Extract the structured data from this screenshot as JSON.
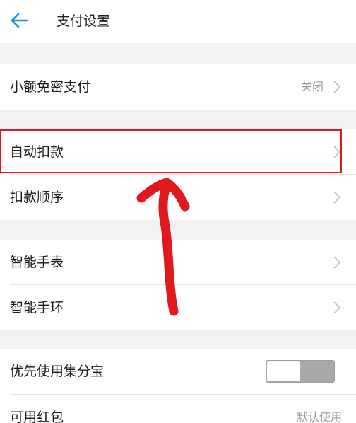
{
  "header": {
    "title": "支付设置",
    "back_icon": "arrow-left-icon",
    "accent": "#1a8ef0"
  },
  "rows": {
    "small_free_pay": {
      "label": "小额免密支付",
      "value": "关闭"
    },
    "auto_deduct": {
      "label": "自动扣款"
    },
    "deduct_order": {
      "label": "扣款顺序"
    },
    "smart_watch": {
      "label": "智能手表"
    },
    "smart_band": {
      "label": "智能手环"
    },
    "prefer_jifenbao": {
      "label": "优先使用集分宝",
      "toggle_on": false
    },
    "red_packet": {
      "label": "可用红包",
      "value": "默认使用"
    }
  },
  "annotation": {
    "highlight_color": "#e0191f"
  }
}
